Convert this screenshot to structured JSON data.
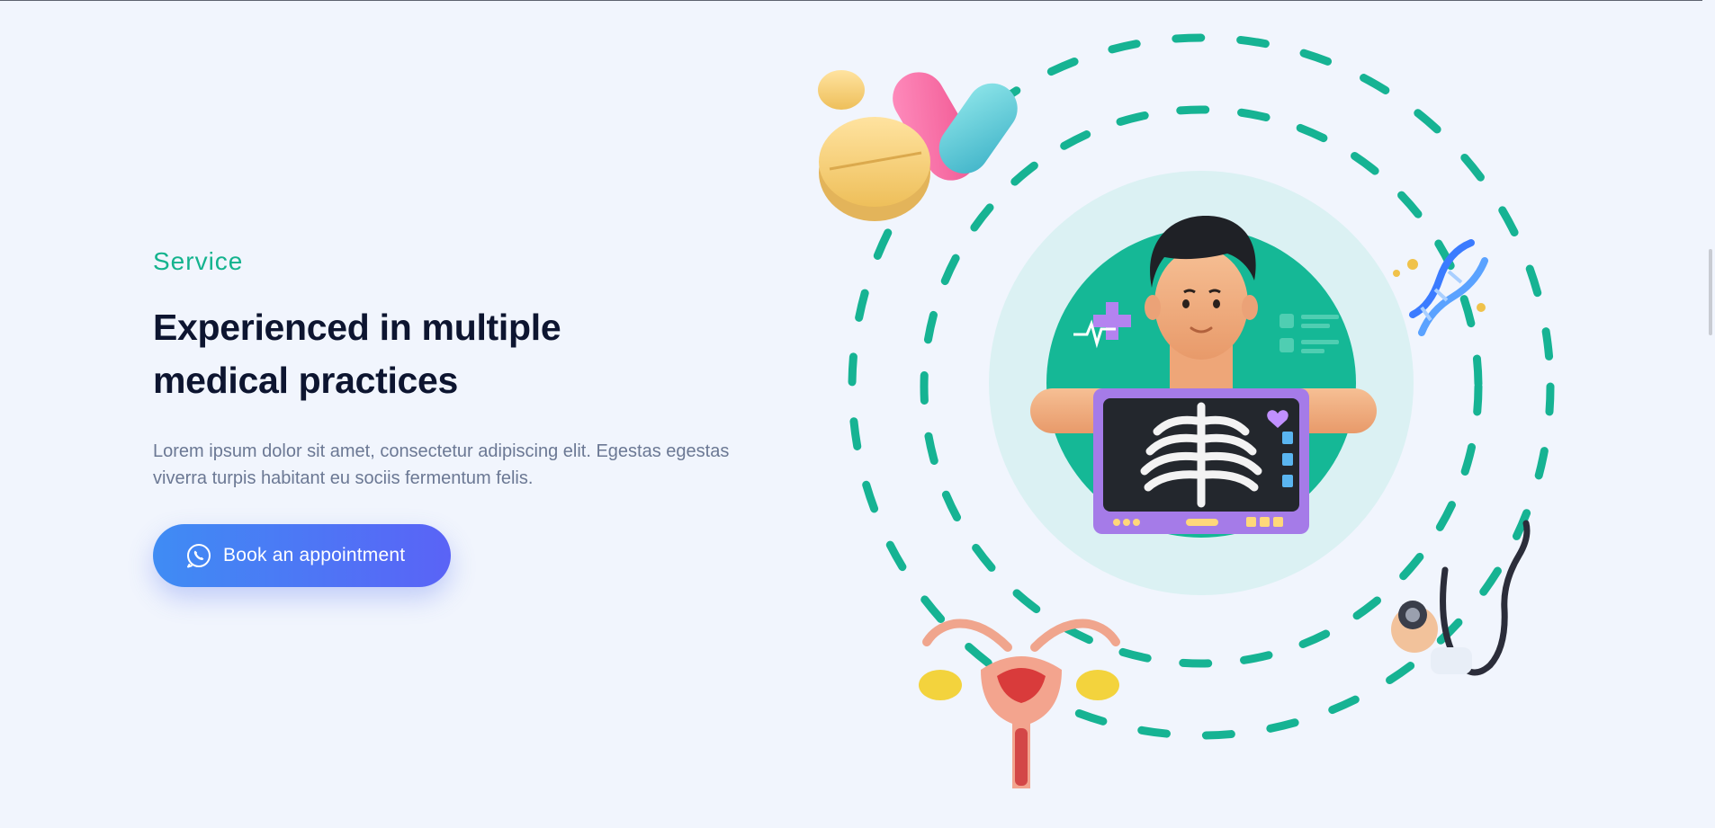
{
  "hero": {
    "eyebrow": "Service",
    "title_line1": "Experienced in multiple",
    "title_line2": "medical practices",
    "description": "Lorem ipsum dolor sit amet, consectetur adipiscing elit. Egestas egestas viverra turpis habitant eu sociis fermentum felis.",
    "cta_label": "Book an appointment",
    "cta_icon": "phone-icon"
  },
  "illustration": {
    "center": "xray-patient-illustration",
    "orbit_items": [
      "pills-icon",
      "dna-icon",
      "stethoscope-icon",
      "uterus-icon"
    ]
  },
  "colors": {
    "accent_green": "#14b38e",
    "title_navy": "#0d1530",
    "body_gray": "#6b7894",
    "cta_gradient_start": "#3f8cf4",
    "cta_gradient_end": "#5a63f6",
    "background": "#f1f5fd"
  }
}
